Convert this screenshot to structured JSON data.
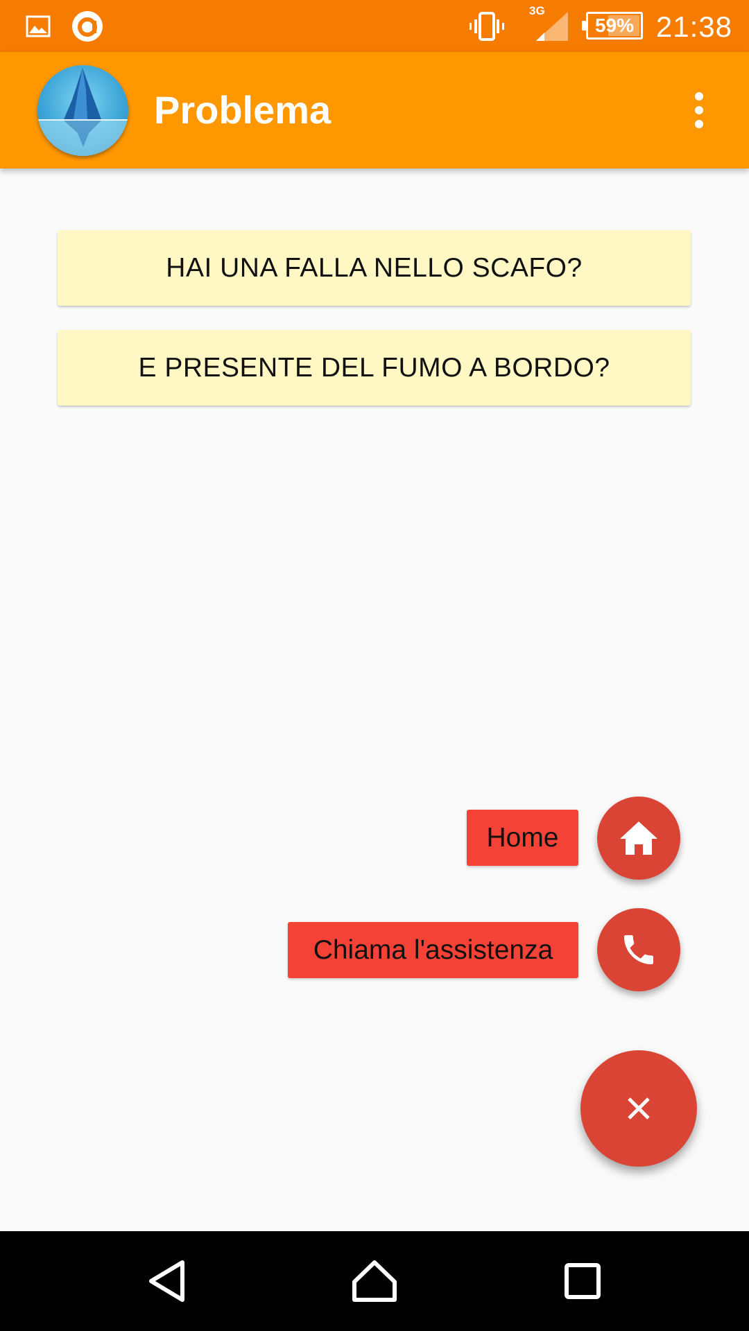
{
  "status_bar": {
    "time": "21:38",
    "battery": "59%",
    "battery_level": 0.59,
    "network": "3G",
    "icons": [
      "gallery-icon",
      "app-notification-icon",
      "vibrate-icon",
      "signal-icon",
      "battery-icon"
    ]
  },
  "app_bar": {
    "title": "Problema",
    "avatar_icon": "iceberg-logo",
    "overflow_icon": "more-vert-icon"
  },
  "questions": [
    {
      "label": "HAI UNA FALLA NELLO SCAFO?"
    },
    {
      "label": "E PRESENTE DEL FUMO A BORDO?"
    }
  ],
  "fab_menu": {
    "items": [
      {
        "label": "Home",
        "icon": "home-icon"
      },
      {
        "label": "Chiama l'assistenza",
        "icon": "phone-icon"
      }
    ],
    "main_icon": "close-icon"
  },
  "nav_bar": {
    "icons": [
      "back-icon",
      "home-nav-icon",
      "recents-icon"
    ]
  },
  "colors": {
    "status_bar": "#f57c00",
    "app_bar": "#ff9800",
    "question_bg": "#fff8c4",
    "fab": "#d94435",
    "fab_label": "#f44336",
    "background": "#fafafa"
  }
}
